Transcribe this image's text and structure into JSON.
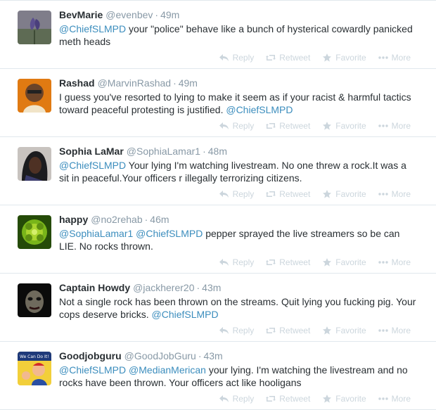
{
  "actions": {
    "reply": "Reply",
    "retweet": "Retweet",
    "favorite": "Favorite",
    "more": "More"
  },
  "tweets": [
    {
      "name": "BevMarie",
      "handle": "@evenbev",
      "time": "49m",
      "segments": [
        {
          "t": "@ChiefSLMPD",
          "m": true
        },
        {
          "t": "    your \"police\" behave like a bunch of hysterical cowardly panicked meth heads",
          "m": false
        }
      ]
    },
    {
      "name": "Rashad",
      "handle": "@MarvinRashad",
      "time": "49m",
      "segments": [
        {
          "t": "I guess you've resorted to lying to make it seem as if your racist & harmful tactics toward peaceful protesting is justified. ",
          "m": false
        },
        {
          "t": "@ChiefSLMPD",
          "m": true
        }
      ]
    },
    {
      "name": "Sophia LaMar",
      "handle": "@SophiaLamar1",
      "time": "48m",
      "segments": [
        {
          "t": "@ChiefSLMPD",
          "m": true
        },
        {
          "t": " Your lying I'm watching livestream. No one threw a rock.It was a sit in peaceful.Your officers r illegally terrorizing citizens.",
          "m": false
        }
      ]
    },
    {
      "name": "happy",
      "handle": "@no2rehab",
      "time": "46m",
      "segments": [
        {
          "t": "@SophiaLamar1",
          "m": true
        },
        {
          "t": " ",
          "m": false
        },
        {
          "t": "@ChiefSLMPD",
          "m": true
        },
        {
          "t": " pepper sprayed the live streamers so be can LIE. No rocks thrown.",
          "m": false
        }
      ]
    },
    {
      "name": "Captain Howdy",
      "handle": "@jackherer20",
      "time": "43m",
      "segments": [
        {
          "t": "Not a single rock has been thrown on the streams. Quit lying you fucking pig. Your cops deserve bricks. ",
          "m": false
        },
        {
          "t": "@ChiefSLMPD",
          "m": true
        }
      ]
    },
    {
      "name": "Goodjobguru",
      "handle": "@GoodJobGuru",
      "time": "43m",
      "avatar_text": "We Can Do It!",
      "segments": [
        {
          "t": "@ChiefSLMPD",
          "m": true
        },
        {
          "t": " ",
          "m": false
        },
        {
          "t": "@MedianMerican",
          "m": true
        },
        {
          "t": " your lying. I'm watching the livestream and no rocks have been thrown. Your officers act like hooligans",
          "m": false
        }
      ]
    }
  ]
}
